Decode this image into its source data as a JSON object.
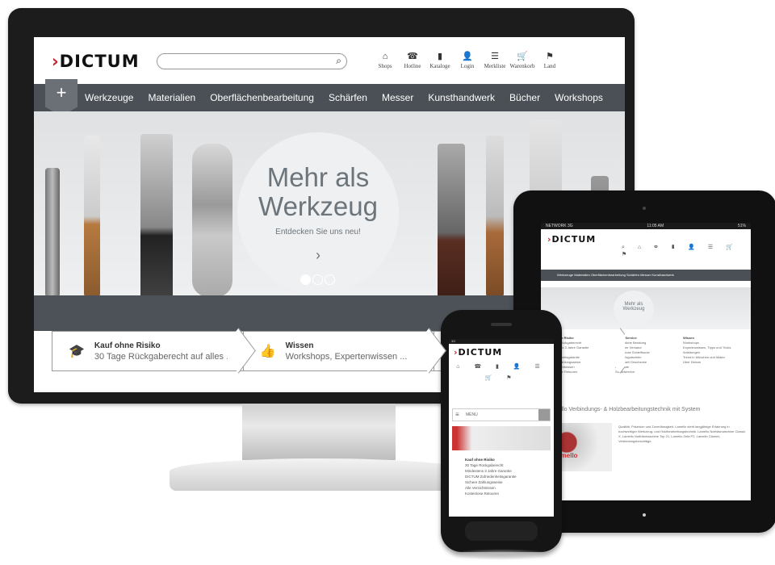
{
  "brand": {
    "logo": "DICTUM"
  },
  "header": {
    "icons": [
      {
        "label": "Shops",
        "icon": "shop-icon",
        "glyph": "⌂"
      },
      {
        "label": "Hotline",
        "icon": "phone-icon",
        "glyph": "☎"
      },
      {
        "label": "Kataloge",
        "icon": "catalog-icon",
        "glyph": "▮"
      },
      {
        "label": "Login",
        "icon": "user-icon",
        "glyph": "👤"
      },
      {
        "label": "Merkliste",
        "icon": "list-icon",
        "glyph": "☰"
      },
      {
        "label": "Warenkorb",
        "icon": "cart-icon",
        "glyph": "🛒"
      },
      {
        "label": "Land",
        "icon": "flag-icon",
        "glyph": "⚑"
      }
    ]
  },
  "nav": {
    "plus": "+",
    "items": [
      "Werkzeuge",
      "Materialien",
      "Oberflächenbearbeitung",
      "Schärfen",
      "Messer",
      "Kunsthandwerk",
      "Bücher",
      "Workshops"
    ]
  },
  "hero": {
    "title_line1": "Mehr als",
    "title_line2": "Werkzeug",
    "subtitle": "Entdecken Sie uns neu!",
    "arrow": "›",
    "active_slide": 1,
    "slide_count": 3
  },
  "features": [
    {
      "title": "Kauf ohne Risiko",
      "subtitle": "30 Tage Rückgaberecht auf alles ...",
      "icon": "cap-icon",
      "glyph": "🎓"
    },
    {
      "title": "Wissen",
      "subtitle": "Workshops, Expertenwissen ...",
      "icon": "thumb-icon",
      "glyph": "👍"
    },
    {
      "title": "",
      "subtitle": "",
      "icon": "service-icon",
      "glyph": "⟳"
    }
  ],
  "tablet": {
    "status_left": "NETWORK 3G",
    "status_center": "11:05 AM",
    "status_right": "51%",
    "logo": "DICTUM",
    "nav": "Werkzeuge  Materialien  Oberflächenbearbeitung  Schärfen  Messer  Kunsthandwerk",
    "hero": "Mehr als Werkzeug",
    "col1_title": "Kauf ohne Risiko",
    "col1_items": [
      "30 Tage Rückgaberecht",
      "Mindestens 3 Jahre Garantie",
      "Zuhause",
      "Zufriedenheitsgarantie",
      "Sichere Zahlungsweise",
      "Alle Versichtnissen",
      "Kostenlose Retouren"
    ],
    "col2_title": "Unser Service",
    "col2_items": [
      "Persönliche Beratung",
      "Schneller Versand",
      "Kostenlose Schleifkurse",
      "Einkaufsgutschein",
      "Individuell Geschenke",
      "Angebote",
      "Schärfservice"
    ],
    "col3_title": "Wissen",
    "col3_items": [
      "Workshops",
      "Expertenwissen, Tipps und Tricks",
      "Anleitungen",
      "Trend in München und Malen",
      "Über Dictum"
    ],
    "headline": "Lamello Verbindungs- & Holzbearbeitungstechnik mit System",
    "body": "Qualität, Präzision und Zuverlässigkeit. Lamello steht langjährige Erfahrung in hochwertiger Werkzeug- und Holzbearbeitungstechnik. Lamello Nutfräsmaschine Classic X, Lamello Nutfräsmaschine Top 21, Lamello Zeta P2, Lamello Clamex, Verbindungsbeschläge.",
    "brand_badge": "lamello"
  },
  "phone": {
    "status": "3G",
    "logo": "DICTUM",
    "menu_label": "MENU",
    "list_title": "Kauf ohne Risiko",
    "list_items": [
      "30 Tage Rückgaberecht",
      "Mindestens 3 Jahre Garantie",
      "DICTUM Zufriedenheitsgarantie",
      "Sichere Zahlungsweise",
      "Alle Versichtnissen",
      "Kostenlose Retouren"
    ]
  }
}
